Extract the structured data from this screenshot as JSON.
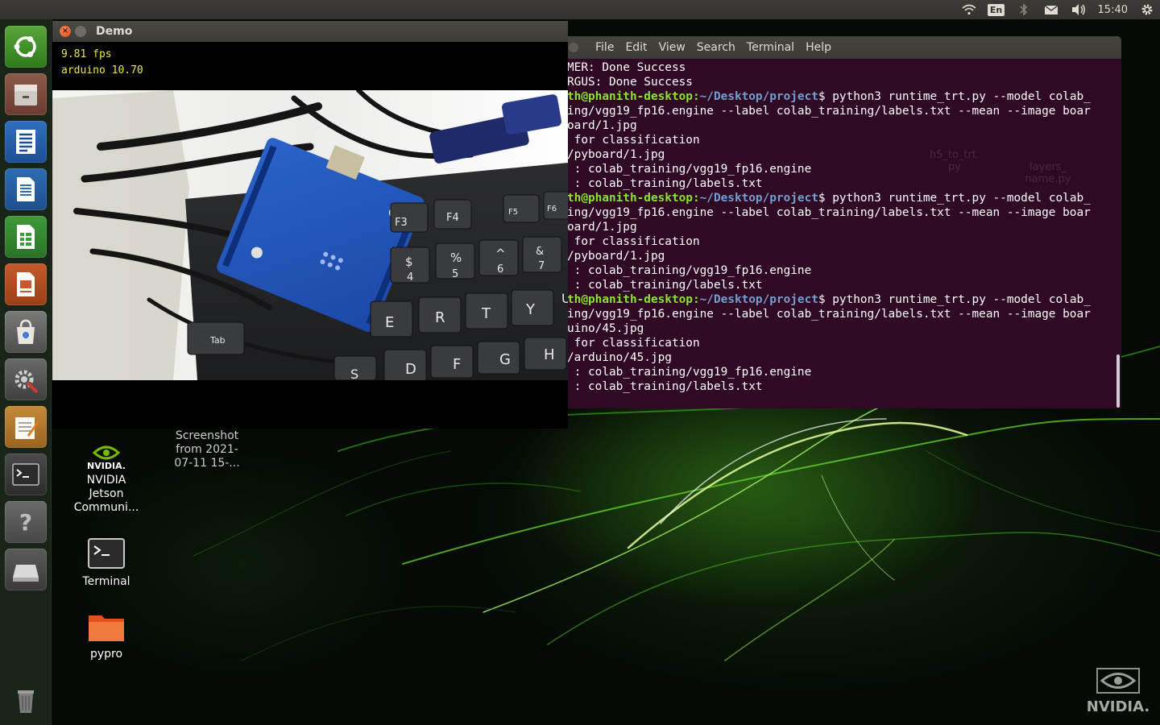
{
  "top_panel": {
    "language_badge": "En",
    "clock": "15:40",
    "icons": [
      "wifi-icon",
      "language-icon",
      "bluetooth-icon",
      "mail-icon",
      "volume-icon",
      "settings-gear-icon"
    ]
  },
  "launcher": {
    "items": [
      "ubuntu-dash-icon",
      "files-icon",
      "document-viewer-icon",
      "libreoffice-writer-icon",
      "libreoffice-calc-icon",
      "libreoffice-impress-icon",
      "software-center-icon",
      "system-settings-icon",
      "text-editor-icon",
      "terminal-icon",
      "help-icon",
      "drive-icon",
      "trash-icon"
    ]
  },
  "desktop_icons": [
    {
      "label_lines": [
        "Screenshot",
        "from 2021-",
        "07-11 15-..."
      ]
    },
    {
      "label_lines": [
        "NVIDIA",
        "Jetson",
        "Communi..."
      ],
      "logo_text": "NVIDIA."
    },
    {
      "label_lines": [
        "Terminal"
      ]
    },
    {
      "label_lines": [
        "pypro"
      ]
    }
  ],
  "demo_window": {
    "title": "Demo",
    "fps_text": "9.81 fps",
    "result_text": "arduino 10.70",
    "camera_keys": [
      "F3",
      "F4",
      "F5",
      "F6",
      "$",
      "4",
      "%",
      "5",
      "^",
      "6",
      "&",
      "7",
      "E",
      "R",
      "T",
      "Y",
      "U",
      "D",
      "F",
      "G",
      "H",
      "S",
      "Tab"
    ]
  },
  "terminal": {
    "menu": [
      "File",
      "Edit",
      "View",
      "Search",
      "Terminal",
      "Help"
    ],
    "lines": [
      {
        "plain": "MER: Done Success"
      },
      {
        "plain": "RGUS: Done Success"
      },
      {
        "user": "th@phanith-desktop",
        "path": "~/Desktop/project",
        "cmd": "$ python3 runtime_trt.py --model colab_"
      },
      {
        "plain": "ing/vgg19_fp16.engine --label colab_training/labels.txt --mean --image boar"
      },
      {
        "plain": "oard/1.jpg"
      },
      {
        "plain": " for classification"
      },
      {
        "plain": "/pyboard/1.jpg"
      },
      {
        "plain": " : colab_training/vgg19_fp16.engine"
      },
      {
        "plain": " : colab_training/labels.txt"
      },
      {
        "user": "th@phanith-desktop",
        "path": "~/Desktop/project",
        "cmd": "$ python3 runtime_trt.py --model colab_"
      },
      {
        "plain": "ing/vgg19_fp16.engine --label colab_training/labels.txt --mean --image boar"
      },
      {
        "plain": "oard/1.jpg"
      },
      {
        "plain": " for classification"
      },
      {
        "plain": "/pyboard/1.jpg"
      },
      {
        "plain": " : colab_training/vgg19_fp16.engine"
      },
      {
        "plain": " : colab_training/labels.txt"
      },
      {
        "user": "th@phanith-desktop",
        "path": "~/Desktop/project",
        "cmd": "$ python3 runtime_trt.py --model colab_"
      },
      {
        "plain": "ing/vgg19_fp16.engine --label colab_training/labels.txt --mean --image boar"
      },
      {
        "plain": "uino/45.jpg"
      },
      {
        "plain": " for classification"
      },
      {
        "plain": "/arduino/45.jpg"
      },
      {
        "plain": " : colab_training/vgg19_fp16.engine"
      },
      {
        "plain": " : colab_training/labels.txt"
      }
    ],
    "ghost_icons": [
      {
        "label_lines": [
          "h5_to_trt.",
          "py"
        ]
      },
      {
        "label_lines": [
          "layers_",
          "name.py"
        ]
      }
    ]
  },
  "watermark": {
    "text": "NVIDIA."
  }
}
